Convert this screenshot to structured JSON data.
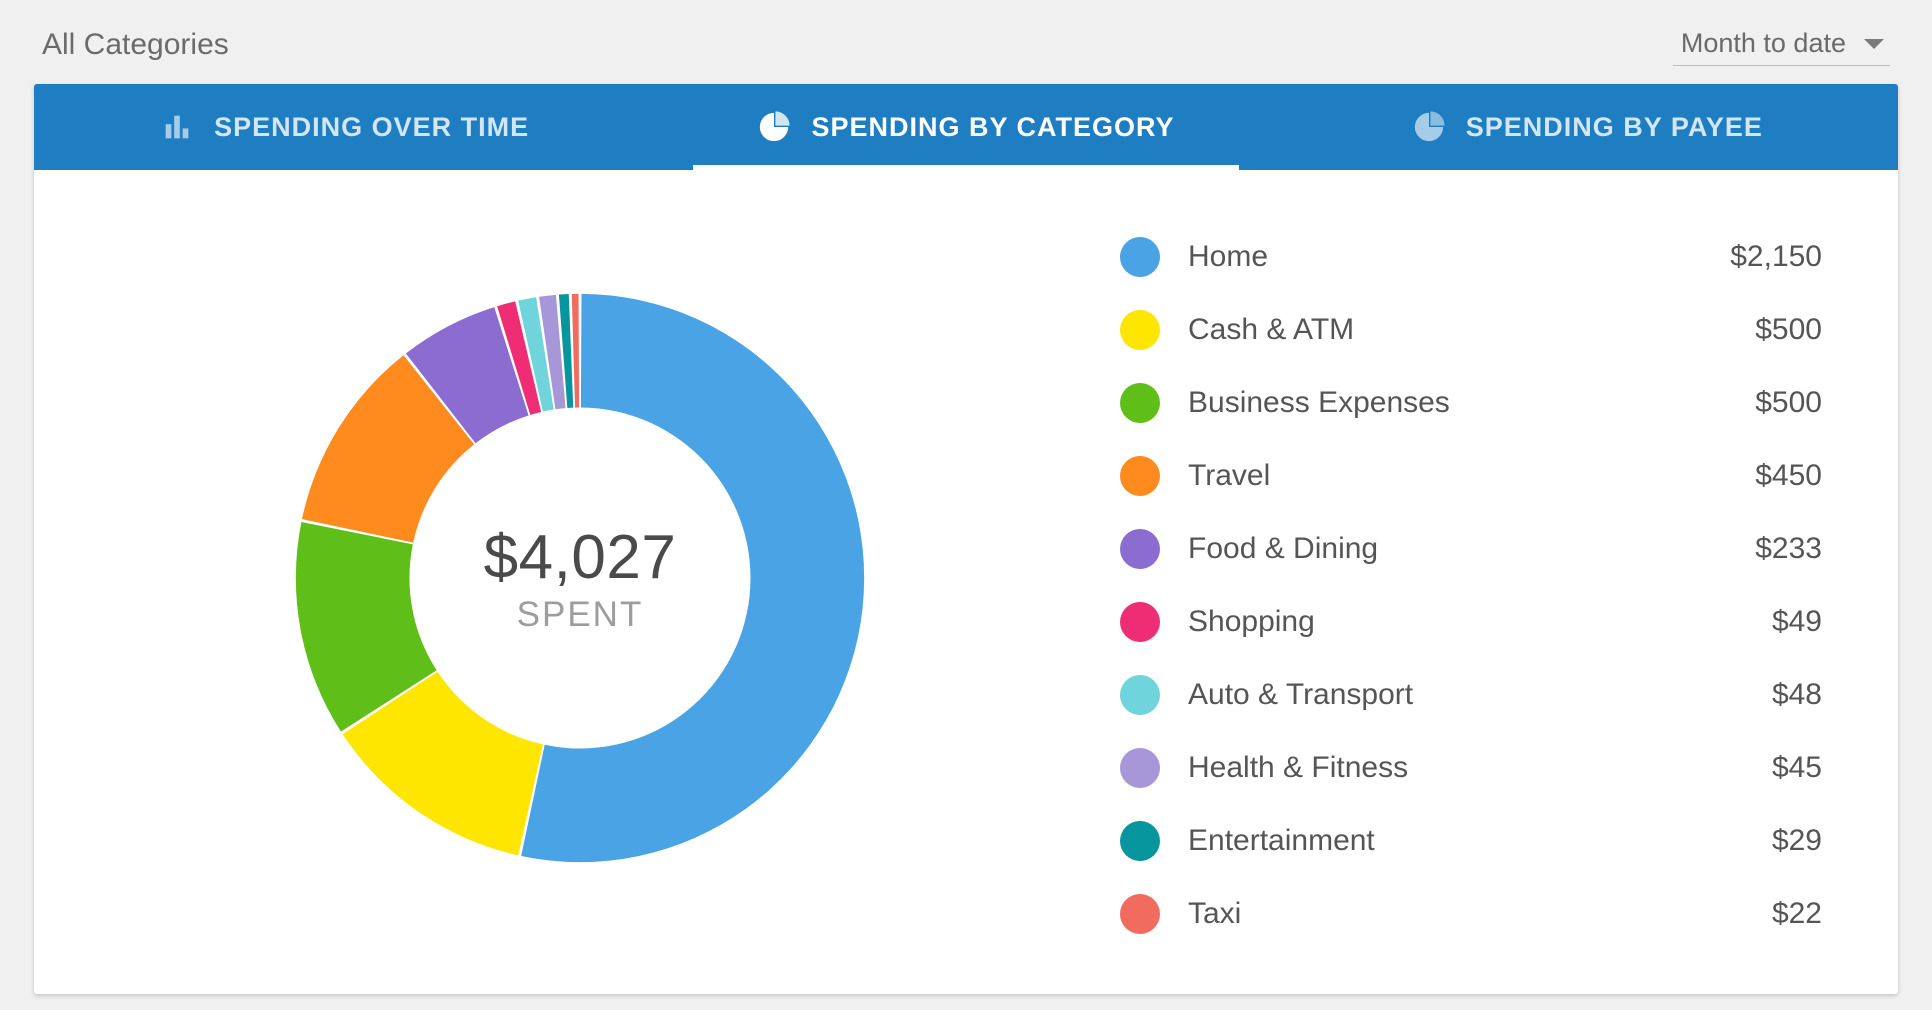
{
  "header": {
    "breadcrumb": "All Categories",
    "date_range_selected": "Month to date"
  },
  "tabs": [
    {
      "id": "over-time",
      "label": "SPENDING OVER TIME",
      "icon": "bar-chart-icon",
      "active": false
    },
    {
      "id": "by-category",
      "label": "SPENDING BY CATEGORY",
      "icon": "pie-chart-icon",
      "active": true
    },
    {
      "id": "by-payee",
      "label": "SPENDING BY PAYEE",
      "icon": "pie-chart-icon",
      "active": false
    }
  ],
  "center": {
    "total_display": "$4,027",
    "caption": "SPENT"
  },
  "categories": [
    {
      "label": "Home",
      "amount_display": "$2,150",
      "value": 2150,
      "color": "#4aa3e4"
    },
    {
      "label": "Cash & ATM",
      "amount_display": "$500",
      "value": 500,
      "color": "#ffe600"
    },
    {
      "label": "Business Expenses",
      "amount_display": "$500",
      "value": 500,
      "color": "#5fbf18"
    },
    {
      "label": "Travel",
      "amount_display": "$450",
      "value": 450,
      "color": "#ff8a1e"
    },
    {
      "label": "Food & Dining",
      "amount_display": "$233",
      "value": 233,
      "color": "#8b6cd1"
    },
    {
      "label": "Shopping",
      "amount_display": "$49",
      "value": 49,
      "color": "#ef2d74"
    },
    {
      "label": "Auto & Transport",
      "amount_display": "$48",
      "value": 48,
      "color": "#6fd4db"
    },
    {
      "label": "Health & Fitness",
      "amount_display": "$45",
      "value": 45,
      "color": "#a897d8"
    },
    {
      "label": "Entertainment",
      "amount_display": "$29",
      "value": 29,
      "color": "#07959e"
    },
    {
      "label": "Taxi",
      "amount_display": "$22",
      "value": 22,
      "color": "#f16b5f"
    }
  ],
  "chart_data": {
    "type": "pie",
    "title": "Spending by Category",
    "series": [
      {
        "name": "Spending",
        "categories": [
          "Home",
          "Cash & ATM",
          "Business Expenses",
          "Travel",
          "Food & Dining",
          "Shopping",
          "Auto & Transport",
          "Health & Fitness",
          "Entertainment",
          "Taxi"
        ],
        "values": [
          2150,
          500,
          500,
          450,
          233,
          49,
          48,
          45,
          29,
          22
        ],
        "colors": [
          "#4aa3e4",
          "#ffe600",
          "#5fbf18",
          "#ff8a1e",
          "#8b6cd1",
          "#ef2d74",
          "#6fd4db",
          "#a897d8",
          "#07959e",
          "#f16b5f"
        ]
      }
    ],
    "total": 4027,
    "total_label": "SPENT",
    "donut": true
  }
}
